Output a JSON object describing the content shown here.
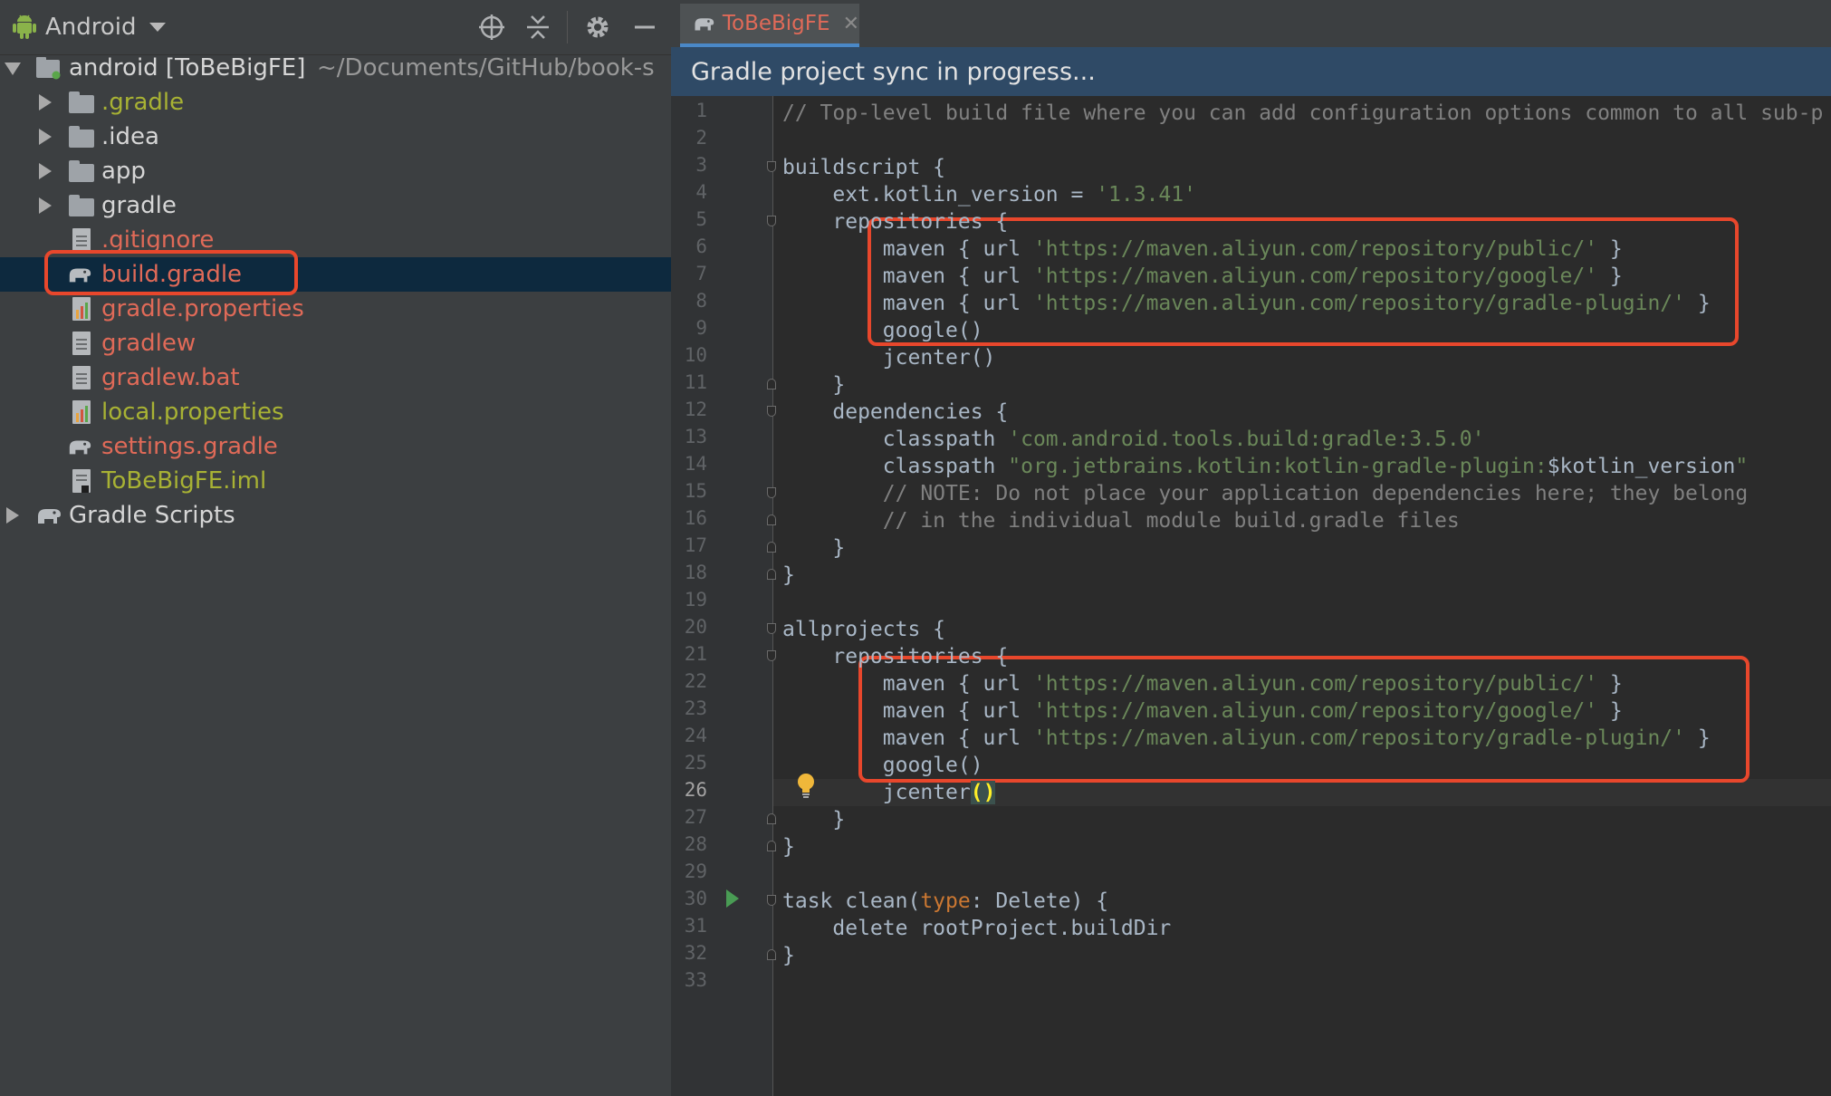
{
  "project_panel": {
    "view_selector": {
      "label": "Android",
      "icon": "android-icon"
    },
    "toolbar_icons": [
      "locate-icon",
      "collapse-all-icon",
      "gear-icon",
      "minimize-icon"
    ],
    "tree": {
      "root": {
        "name": "android [ToBeBigFE]",
        "path": "~/Documents/GitHub/book-s",
        "icon": "module-icon"
      },
      "items": [
        {
          "label": ".gradle",
          "icon": "folder-icon"
        },
        {
          "label": ".idea",
          "icon": "folder-icon"
        },
        {
          "label": "app",
          "icon": "folder-icon"
        },
        {
          "label": "gradle",
          "icon": "folder-icon"
        },
        {
          "label": ".gitignore",
          "icon": "text-file-icon"
        },
        {
          "label": "build.gradle",
          "icon": "gradle-elephant-icon"
        },
        {
          "label": "gradle.properties",
          "icon": "properties-file-icon"
        },
        {
          "label": "gradlew",
          "icon": "text-file-icon"
        },
        {
          "label": "gradlew.bat",
          "icon": "text-file-icon"
        },
        {
          "label": "local.properties",
          "icon": "properties-file-icon"
        },
        {
          "label": "settings.gradle",
          "icon": "gradle-elephant-icon"
        },
        {
          "label": "ToBeBigFE.iml",
          "icon": "iml-file-icon"
        }
      ],
      "gradle_scripts": {
        "label": "Gradle Scripts",
        "icon": "gradle-elephant-icon"
      }
    }
  },
  "editor": {
    "tab": {
      "label": "ToBeBigFE",
      "close": "✕",
      "icon": "gradle-elephant-icon"
    },
    "sync_banner": "Gradle project sync in progress...",
    "current_line": 26,
    "colors": {
      "accent": "#4a88c7",
      "highlight_box": "#e8472c",
      "selection": "#0d293e"
    },
    "lines": [
      {
        "n": "1",
        "tokens": [
          {
            "t": "// Top-level build file where you can add configuration options common to all sub-p",
            "k": "com"
          }
        ]
      },
      {
        "n": "2",
        "tokens": []
      },
      {
        "n": "3",
        "tokens": [
          {
            "t": "buildscript {",
            "k": "plain"
          }
        ]
      },
      {
        "n": "4",
        "tokens": [
          {
            "t": "    ext.kotlin_version = ",
            "k": "plain"
          },
          {
            "t": "'1.3.41'",
            "k": "str"
          }
        ]
      },
      {
        "n": "5",
        "tokens": [
          {
            "t": "    repositories {",
            "k": "plain"
          }
        ]
      },
      {
        "n": "6",
        "tokens": [
          {
            "t": "        maven { url ",
            "k": "plain"
          },
          {
            "t": "'https://maven.aliyun.com/repository/public/'",
            "k": "str"
          },
          {
            "t": " }",
            "k": "plain"
          }
        ]
      },
      {
        "n": "7",
        "tokens": [
          {
            "t": "        maven { url ",
            "k": "plain"
          },
          {
            "t": "'https://maven.aliyun.com/repository/google/'",
            "k": "str"
          },
          {
            "t": " }",
            "k": "plain"
          }
        ]
      },
      {
        "n": "8",
        "tokens": [
          {
            "t": "        maven { url ",
            "k": "plain"
          },
          {
            "t": "'https://maven.aliyun.com/repository/gradle-plugin/'",
            "k": "str"
          },
          {
            "t": " }",
            "k": "plain"
          }
        ]
      },
      {
        "n": "9",
        "tokens": [
          {
            "t": "        google()",
            "k": "plain"
          }
        ]
      },
      {
        "n": "10",
        "tokens": [
          {
            "t": "        jcenter()",
            "k": "plain"
          }
        ]
      },
      {
        "n": "11",
        "tokens": [
          {
            "t": "    }",
            "k": "plain"
          }
        ]
      },
      {
        "n": "12",
        "tokens": [
          {
            "t": "    dependencies {",
            "k": "plain"
          }
        ]
      },
      {
        "n": "13",
        "tokens": [
          {
            "t": "        classpath ",
            "k": "plain"
          },
          {
            "t": "'com.android.tools.build:gradle:3.5.0'",
            "k": "str"
          }
        ]
      },
      {
        "n": "14",
        "tokens": [
          {
            "t": "        classpath ",
            "k": "plain"
          },
          {
            "t": "\"org.jetbrains.kotlin:kotlin-gradle-plugin:",
            "k": "str"
          },
          {
            "t": "$kotlin_version",
            "k": "plain"
          },
          {
            "t": "\"",
            "k": "str"
          }
        ]
      },
      {
        "n": "15",
        "tokens": [
          {
            "t": "        // NOTE: Do not place your application dependencies here; they belong",
            "k": "com"
          }
        ]
      },
      {
        "n": "16",
        "tokens": [
          {
            "t": "        // in the individual module build.gradle files",
            "k": "com"
          }
        ]
      },
      {
        "n": "17",
        "tokens": [
          {
            "t": "    }",
            "k": "plain"
          }
        ]
      },
      {
        "n": "18",
        "tokens": [
          {
            "t": "}",
            "k": "plain"
          }
        ]
      },
      {
        "n": "19",
        "tokens": []
      },
      {
        "n": "20",
        "tokens": [
          {
            "t": "allprojects {",
            "k": "plain"
          }
        ]
      },
      {
        "n": "21",
        "tokens": [
          {
            "t": "    repositories {",
            "k": "plain"
          }
        ]
      },
      {
        "n": "22",
        "tokens": [
          {
            "t": "        maven { url ",
            "k": "plain"
          },
          {
            "t": "'https://maven.aliyun.com/repository/public/'",
            "k": "str"
          },
          {
            "t": " }",
            "k": "plain"
          }
        ]
      },
      {
        "n": "23",
        "tokens": [
          {
            "t": "        maven { url ",
            "k": "plain"
          },
          {
            "t": "'https://maven.aliyun.com/repository/google/'",
            "k": "str"
          },
          {
            "t": " }",
            "k": "plain"
          }
        ]
      },
      {
        "n": "24",
        "tokens": [
          {
            "t": "        maven { url ",
            "k": "plain"
          },
          {
            "t": "'https://maven.aliyun.com/repository/gradle-plugin/'",
            "k": "str"
          },
          {
            "t": " }",
            "k": "plain"
          }
        ]
      },
      {
        "n": "25",
        "tokens": [
          {
            "t": "        google()",
            "k": "plain"
          }
        ]
      },
      {
        "n": "26",
        "tokens": [
          {
            "t": "        jcenter",
            "k": "plain"
          },
          {
            "t": "()",
            "k": "brace"
          }
        ]
      },
      {
        "n": "27",
        "tokens": [
          {
            "t": "    }",
            "k": "plain"
          }
        ]
      },
      {
        "n": "28",
        "tokens": [
          {
            "t": "}",
            "k": "plain"
          }
        ]
      },
      {
        "n": "29",
        "tokens": []
      },
      {
        "n": "30",
        "tokens": [
          {
            "t": "task clean(",
            "k": "plain"
          },
          {
            "t": "type",
            "k": "kw"
          },
          {
            "t": ": Delete) {",
            "k": "plain"
          }
        ]
      },
      {
        "n": "31",
        "tokens": [
          {
            "t": "    delete rootProject.buildDir",
            "k": "plain"
          }
        ]
      },
      {
        "n": "32",
        "tokens": [
          {
            "t": "}",
            "k": "plain"
          }
        ]
      },
      {
        "n": "33",
        "tokens": []
      }
    ]
  }
}
